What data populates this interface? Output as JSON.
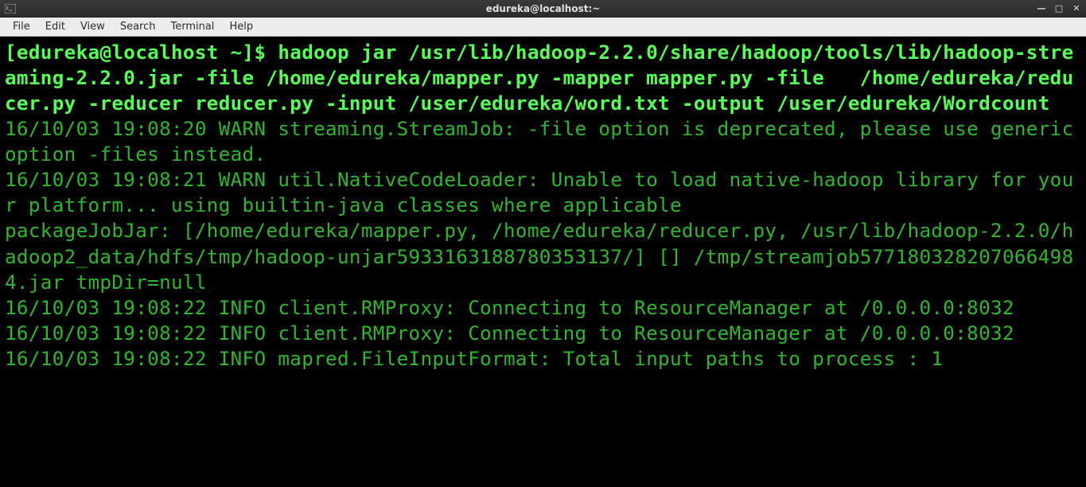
{
  "titlebar": {
    "title": "edureka@localhost:~",
    "minimize": "—",
    "maximize": "□",
    "close": "✕"
  },
  "menubar": {
    "file": "File",
    "edit": "Edit",
    "view": "View",
    "search": "Search",
    "terminal": "Terminal",
    "help": "Help"
  },
  "terminal": {
    "prompt": "[edureka@localhost ~]$ ",
    "command": "hadoop jar /usr/lib/hadoop-2.2.0/share/hadoop/tools/lib/hadoop-streaming-2.2.0.jar -file /home/edureka/mapper.py -mapper mapper.py -file   /home/edureka/reducer.py -reducer reducer.py -input /user/edureka/word.txt -output /user/edureka/Wordcount",
    "output_lines": [
      "16/10/03 19:08:20 WARN streaming.StreamJob: -file option is deprecated, please use generic option -files instead.",
      "16/10/03 19:08:21 WARN util.NativeCodeLoader: Unable to load native-hadoop library for your platform... using builtin-java classes where applicable",
      "packageJobJar: [/home/edureka/mapper.py, /home/edureka/reducer.py, /usr/lib/hadoop-2.2.0/hadoop2_data/hdfs/tmp/hadoop-unjar5933163188780353137/] [] /tmp/streamjob5771803282070664984.jar tmpDir=null",
      "16/10/03 19:08:22 INFO client.RMProxy: Connecting to ResourceManager at /0.0.0.0:8032",
      "16/10/03 19:08:22 INFO client.RMProxy: Connecting to ResourceManager at /0.0.0.0:8032",
      "16/10/03 19:08:22 INFO mapred.FileInputFormat: Total input paths to process : 1"
    ]
  }
}
